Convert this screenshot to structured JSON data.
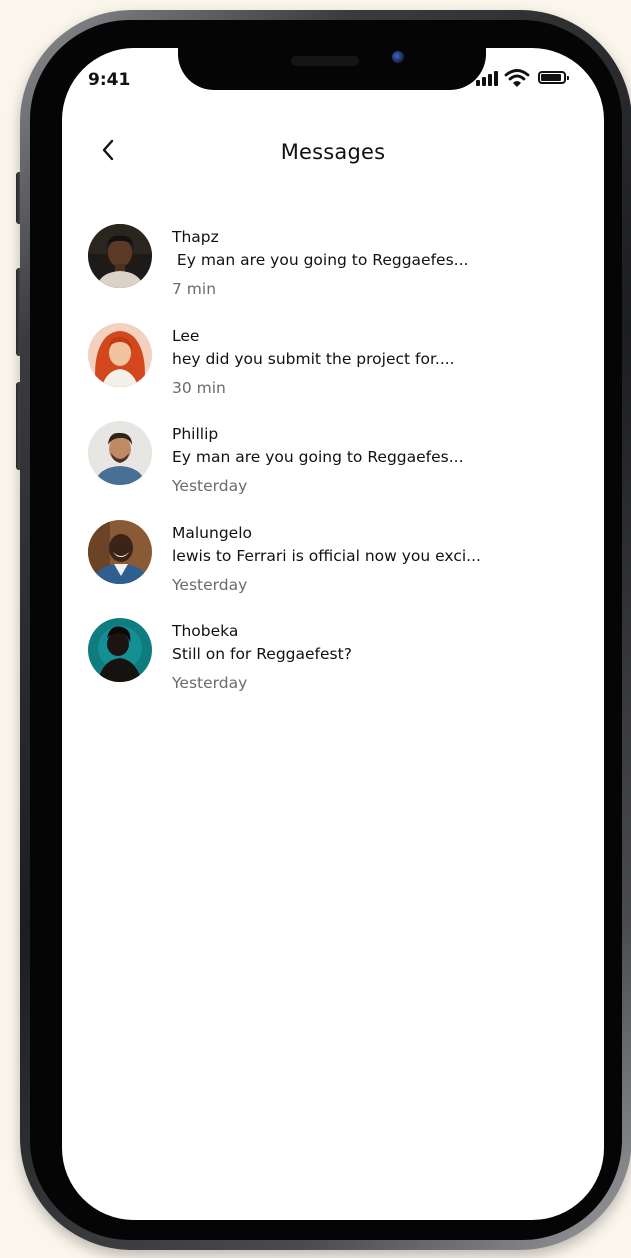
{
  "status_bar": {
    "time": "9:41"
  },
  "header": {
    "title": "Messages"
  },
  "conversations": [
    {
      "name": "Thapz",
      "preview": " Ey man are you going to Reggaefes...",
      "time": "7 min"
    },
    {
      "name": "Lee",
      "preview": "hey did you submit the project for....",
      "time": "30 min"
    },
    {
      "name": "Phillip",
      "preview": "Ey man are you going to Reggaefes...",
      "time": "Yesterday"
    },
    {
      "name": "Malungelo",
      "preview": "lewis to Ferrari is official now you exci...",
      "time": "Yesterday"
    },
    {
      "name": "Thobeka",
      "preview": "Still on for Reggaefest?",
      "time": "Yesterday"
    }
  ],
  "colors": {
    "background": "#fbf6ec",
    "screen": "#ffffff",
    "text": "#111111",
    "muted_text": "#6b6b6b"
  },
  "icons": {
    "back": "chevron-left-icon",
    "signal": "signal-icon",
    "wifi": "wifi-icon",
    "battery": "battery-icon"
  }
}
